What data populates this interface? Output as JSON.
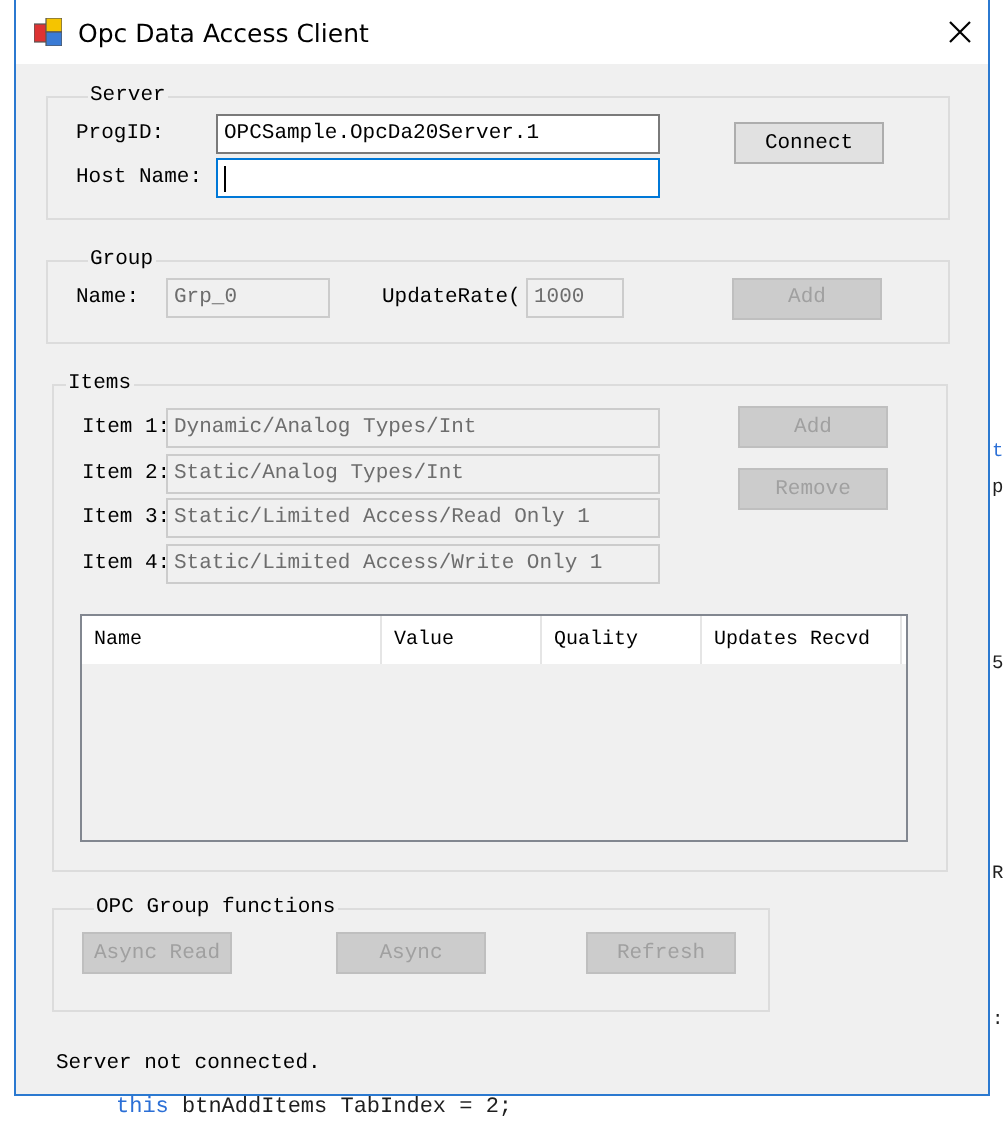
{
  "window": {
    "title": "Opc Data Access Client"
  },
  "server": {
    "legend": "Server",
    "fields": [
      {
        "label": "ProgID:",
        "value": "OPCSample.OpcDa20Server.1",
        "focused": false
      },
      {
        "label": "Host Name:",
        "focused": true
      }
    ],
    "connect_button": {
      "label": "Connect",
      "disabled": false
    }
  },
  "group": {
    "legend": "Group",
    "name_label": "Name:",
    "name_value": "Grp_0",
    "rate_label": "UpdateRate(",
    "rate_value": "1000",
    "fields_disabled": true,
    "add_button": {
      "label": "Add",
      "disabled": true
    }
  },
  "items": {
    "legend": "Items",
    "fields_disabled": true,
    "rows": [
      {
        "label": "Item 1:",
        "value": "Dynamic/Analog Types/Int"
      },
      {
        "label": "Item 2:",
        "value": "Static/Analog Types/Int"
      },
      {
        "label": "Item 3:",
        "value": "Static/Limited Access/Read Only 1"
      },
      {
        "label": "Item 4:",
        "value": "Static/Limited Access/Write Only 1"
      }
    ],
    "buttons": [
      {
        "label": "Add",
        "disabled": true
      },
      {
        "label": "Remove",
        "disabled": true
      }
    ],
    "table": {
      "columns": [
        "Name",
        "Value",
        "Quality",
        "Updates Recvd"
      ]
    }
  },
  "functions": {
    "legend": "OPC Group functions",
    "buttons": [
      {
        "label": "Async Read",
        "disabled": true
      },
      {
        "label": "Async",
        "disabled": true
      },
      {
        "label": "Refresh",
        "disabled": true
      }
    ]
  },
  "status_bar": {
    "text": "Server not connected."
  },
  "background_code": {
    "edge_fragments": [
      {
        "text": "t",
        "kind": "keyword"
      },
      {
        "text": "p",
        "kind": "plain"
      },
      {
        "text": "5",
        "kind": "plain"
      },
      {
        "text": "R",
        "kind": "plain"
      },
      {
        "text": ":",
        "kind": "plain"
      }
    ],
    "line": [
      {
        "text": "this",
        "kind": "keyword"
      },
      {
        "text": " btnAddItems TabIndex = 2;",
        "kind": "plain"
      }
    ]
  }
}
